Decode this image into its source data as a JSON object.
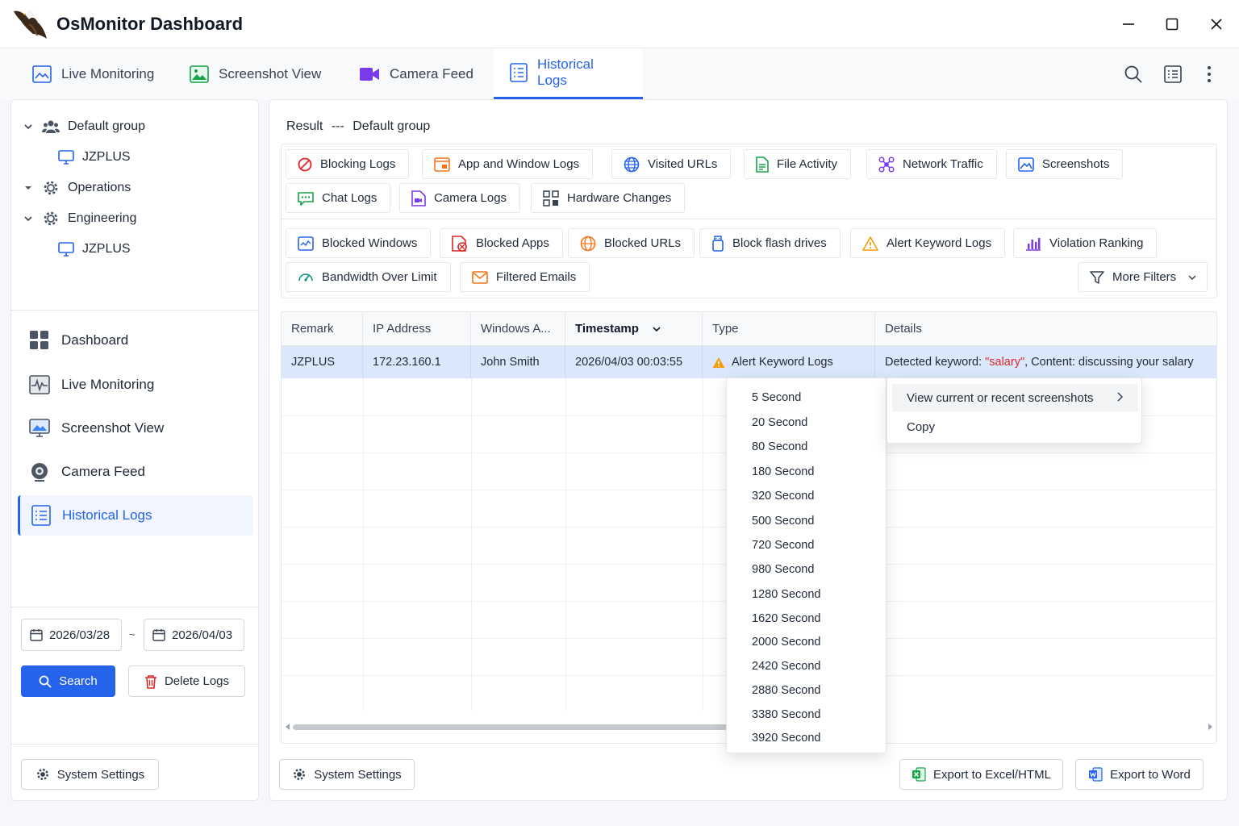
{
  "app": {
    "title": "OsMonitor Dashboard"
  },
  "tabs": [
    {
      "label": "Live Monitoring"
    },
    {
      "label": "Screenshot View"
    },
    {
      "label": "Camera Feed"
    },
    {
      "label": "Historical Logs",
      "active": true
    }
  ],
  "tree": [
    {
      "label": "Default group",
      "expanded": true,
      "children": [
        "JZPLUS"
      ]
    },
    {
      "label": "Operations",
      "expanded": false
    },
    {
      "label": "Engineering",
      "expanded": true,
      "children": [
        "JZPLUS"
      ]
    }
  ],
  "nav": [
    {
      "label": "Dashboard"
    },
    {
      "label": "Live Monitoring"
    },
    {
      "label": "Screenshot View"
    },
    {
      "label": "Camera Feed"
    },
    {
      "label": "Historical Logs",
      "active": true
    }
  ],
  "date_range": {
    "start": "2026/03/28",
    "separator": "~",
    "end": "2026/04/03"
  },
  "buttons": {
    "search": "Search",
    "delete_logs": "Delete Logs",
    "system_settings": "System Settings",
    "export_excel": "Export to Excel/HTML",
    "export_word": "Export to Word"
  },
  "result": {
    "label": "Result",
    "separator": "---",
    "group": "Default group"
  },
  "filters_row1": [
    "Blocking Logs",
    "App and Window Logs",
    "Visited URLs",
    "File Activity",
    "Network Traffic",
    "Screenshots",
    "Chat Logs",
    "Camera Logs",
    "Hardware Changes"
  ],
  "filters_row2": [
    "Blocked Windows",
    "Blocked Apps",
    "Blocked URLs",
    "Block flash drives",
    "Alert Keyword Logs",
    "Violation Ranking",
    "Bandwidth Over Limit",
    "Filtered Emails"
  ],
  "more_filters": "More Filters",
  "table": {
    "columns": [
      "Remark",
      "IP Address",
      "Windows A...",
      "Timestamp",
      "Type",
      "Details"
    ],
    "rows": [
      {
        "remark": "JZPLUS",
        "ip": "172.23.160.1",
        "user": "John Smith",
        "timestamp": "2026/04/03 00:03:55",
        "type": "Alert Keyword Logs",
        "details_prefix": "Detected keyword: ",
        "keyword": "\"salary\"",
        "details_suffix": ", Content: discussing your salary"
      }
    ]
  },
  "context_menu": {
    "items": [
      "View current or recent screenshots",
      "Copy"
    ]
  },
  "seconds_menu": [
    "5 Second",
    "20 Second",
    "80 Second",
    "180 Second",
    "320 Second",
    "500 Second",
    "720 Second",
    "980 Second",
    "1280 Second",
    "1620 Second",
    "2000 Second",
    "2420 Second",
    "2880 Second",
    "3380 Second",
    "3920 Second"
  ],
  "colors": {
    "accent": "#2563eb",
    "selected_row": "#dbe7fb",
    "keyword": "#dc2626",
    "warning": "#f59e0b"
  }
}
